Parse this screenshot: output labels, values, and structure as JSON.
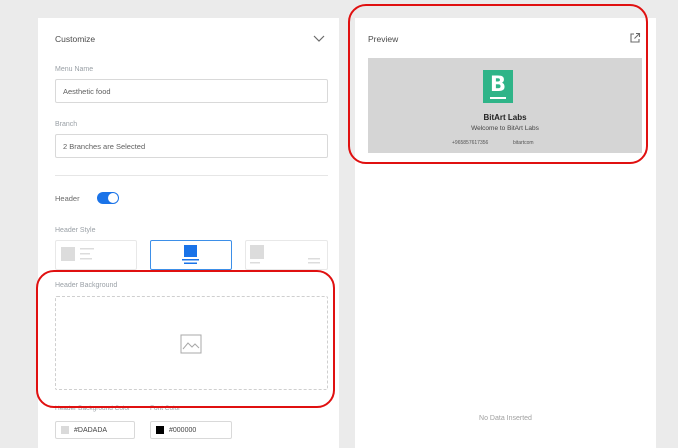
{
  "customize": {
    "title": "Customize",
    "menu_name": {
      "label": "Menu Name",
      "value": "Aesthetic food"
    },
    "branch": {
      "label": "Branch",
      "value": "2 Branches are Selected"
    },
    "header": {
      "label": "Header",
      "toggle_on": true
    },
    "header_style": {
      "label": "Header Style",
      "selected_index": 1
    },
    "header_background": {
      "label": "Header Background"
    },
    "colors": {
      "background_label": "Header Background Color",
      "background_value": "#DADADA",
      "font_label": "Font Color",
      "font_value": "#000000"
    }
  },
  "preview": {
    "title": "Preview",
    "brand_name": "BitArt Labs",
    "welcome": "Welcome to BitArt Labs",
    "phone": "+965857617356",
    "handle": "bitartcom",
    "empty_text": "No Data Inserted"
  },
  "colors": {
    "accent": "#1a73e8",
    "logo_green": "#2fb488",
    "highlight_red": "#e01010",
    "preview_bg": "#d5d5d5"
  }
}
